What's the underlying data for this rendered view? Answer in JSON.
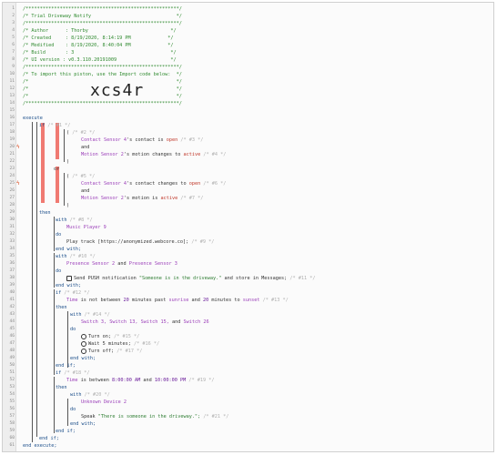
{
  "header": {
    "rule": "/******************************************************/",
    "title": "/* Trial Driveway Notify                              */",
    "author": "/* Author      : Thorby                             */",
    "created": "/* Created     : 8/19/2020, 8:14:19 PM             */",
    "modified": "/* Modified    : 8/19/2020, 8:40:04 PM             */",
    "build": "/* Build       : 3                                  */",
    "ui": "/* UI version : v0.3.110.20191009                   */",
    "import": "/* To import this piston, use the Import code below:  */",
    "blank": "/*                                                    */",
    "code": "xcs4r"
  },
  "code": {
    "execute": "execute",
    "if1": "if",
    "c1": "/* #1 */",
    "paren_open": "(",
    "c2": "/* #2 */",
    "sensor4": "Contact Sensor 4",
    "s4_contact_is": "'s contact is",
    "open": "open",
    "c3": "/* #3 */",
    "and": "and",
    "motion2": "Motion Sensor 2",
    "m2_changes": "'s motion changes to",
    "active": "active",
    "c4": "/* #4 */",
    "paren_close": ")",
    "or": "or",
    "c5": "/* #5 */",
    "s4_changes": "'s contact changes to",
    "c6": "/* #6 */",
    "m2_is": "'s motion is",
    "c7": "/* #7 */",
    "then": "then",
    "with": "with",
    "c8": "/* #8 */",
    "player": "Music Player 9",
    "do": "do",
    "play": "Play track [https://anonymized.webcore.co];",
    "c9": "/* #9 */",
    "endwith": "end with;",
    "c10": "/* #10 */",
    "presence_a": "Presence Sensor 2",
    "presence_and": "and",
    "presence_b": "Presence Sensor 3",
    "push_a": "Send PUSH notification",
    "push_str": "\"Someone is in the driveway.\"",
    "push_b": "and store in Messages;",
    "c11": "/* #11 */",
    "if": "if",
    "c12": "/* #12 */",
    "time": "Time",
    "not_between": "is not between",
    "m20": "20",
    "minutes_past": "minutes past",
    "sunrise": "sunrise",
    "and2": "and",
    "minutes_to": "minutes to",
    "sunset": "sunset",
    "c13": "/* #13 */",
    "c14": "/* #14 */",
    "switches": "Switch 3, Switch 13, Switch 15,",
    "switch_and": "and",
    "switch26": "Switch 26",
    "turn_on": "Turn on;",
    "c15": "/* #15 */",
    "wait": "Wait 5 minutes;",
    "c16": "/* #16 */",
    "turn_off": "Turn off;",
    "c17": "/* #17 */",
    "endif": "end if;",
    "c18": "/* #18 */",
    "between": "is between",
    "t1": "8:00:00 AM",
    "t2": "10:00:00 PM",
    "c19": "/* #19 */",
    "c20": "/* #20 */",
    "unknown": "Unknown Device 2",
    "speak_a": "Speak",
    "speak_str": "\"There is someone in the driveway.\";",
    "c21": "/* #21 */",
    "endexecute": "end execute;"
  },
  "line_numbers": [
    "1",
    "2",
    "3",
    "4",
    "5",
    "6",
    "7",
    "8",
    "9",
    "10",
    "11",
    "12",
    "13",
    "14",
    "15",
    "16",
    "17",
    "18",
    "19",
    "20",
    "21",
    "22",
    "23",
    "24",
    "25",
    "26",
    "27",
    "28",
    "29",
    "30",
    "31",
    "32",
    "33",
    "34",
    "35",
    "36",
    "37",
    "38",
    "39",
    "40",
    "41",
    "42",
    "43",
    "44",
    "45",
    "46",
    "47",
    "48",
    "49",
    "50",
    "51",
    "52",
    "53",
    "54",
    "55",
    "56",
    "57",
    "58",
    "59",
    "60",
    "61"
  ]
}
